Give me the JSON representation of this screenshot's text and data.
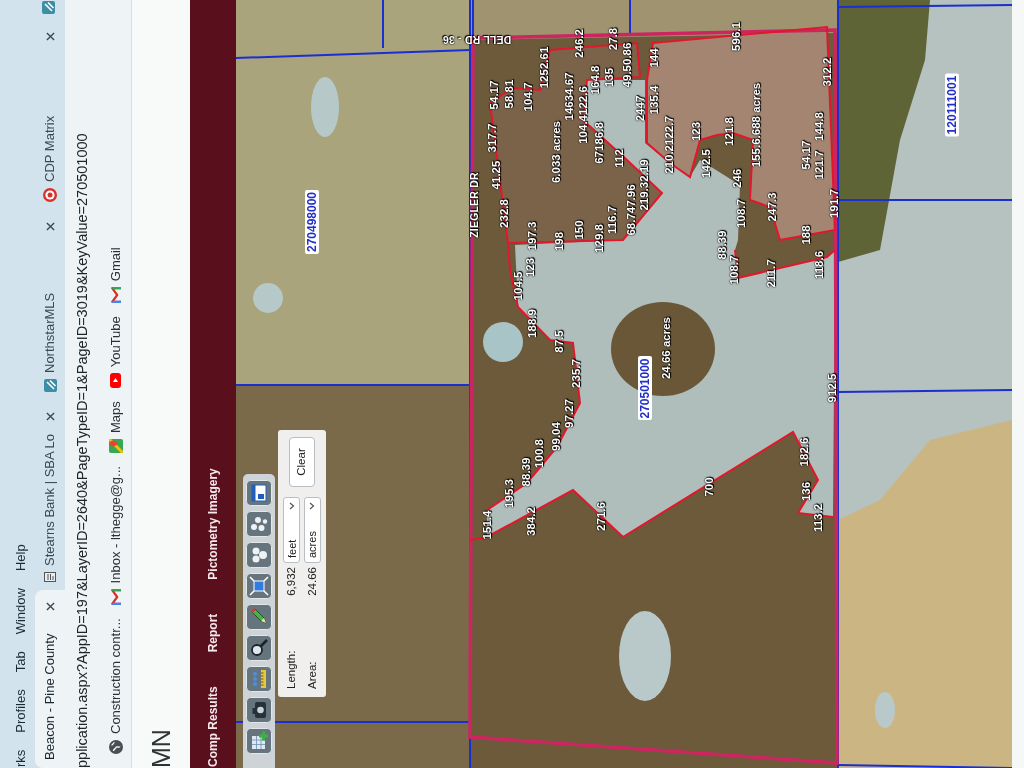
{
  "menu_bar": {
    "items": [
      "rks",
      "Profiles",
      "Tab",
      "Window",
      "Help"
    ]
  },
  "tabs": [
    {
      "title": "Beacon - Pine County",
      "selected": true
    },
    {
      "title": "Stearns Bank | SBA Lo",
      "selected": false
    },
    {
      "title": "NorthstarMLS",
      "selected": false
    },
    {
      "title": "CDP Matrix",
      "selected": false
    }
  ],
  "address_bar": {
    "url": "pplication.aspx?AppID=197&LayerID=2640&PageTypeID=1&PageID=3019&KeyValue=270501000"
  },
  "bookmarks": [
    "Construction contr...",
    "Inbox - lthegge@g...",
    "Maps",
    "YouTube",
    "Gmail"
  ],
  "header": {
    "title": "MN"
  },
  "nav": [
    "Comp Results",
    "Report",
    "Pictometry Imagery"
  ],
  "map": {
    "measure_panel": {
      "rows": [
        {
          "label": "Length:",
          "value": "6,932",
          "unit": "feet"
        },
        {
          "label": "Area:",
          "value": "24.66",
          "unit": "acres"
        }
      ],
      "clear_button": "Clear"
    },
    "labels": [
      {
        "kind": "parcel",
        "text": "270498000"
      },
      {
        "kind": "road",
        "text": "DELL RD - 36"
      },
      {
        "kind": "road",
        "text": "ZIEGLER DR"
      },
      {
        "kind": "measure",
        "text": "151.4"
      },
      {
        "kind": "measure",
        "text": "54.17"
      },
      {
        "kind": "measure",
        "text": "317.7"
      },
      {
        "kind": "measure",
        "text": "41.25"
      },
      {
        "kind": "measure",
        "text": "232.8"
      },
      {
        "kind": "measure",
        "text": "58.81"
      },
      {
        "kind": "measure",
        "text": "195.3"
      },
      {
        "kind": "measure",
        "text": "104.5"
      },
      {
        "kind": "measure",
        "text": "123"
      },
      {
        "kind": "measure",
        "text": "104.7"
      },
      {
        "kind": "measure",
        "text": "88.39"
      },
      {
        "kind": "measure",
        "text": "384.2"
      },
      {
        "kind": "measure",
        "text": "197.3"
      },
      {
        "kind": "measure",
        "text": "188.9"
      },
      {
        "kind": "measure",
        "text": "100.8"
      },
      {
        "kind": "measure",
        "text": "1252.61"
      },
      {
        "kind": "measure",
        "text": "6.033 acres"
      },
      {
        "kind": "measure",
        "text": "99.04"
      },
      {
        "kind": "measure",
        "text": "198"
      },
      {
        "kind": "measure",
        "text": "87.5"
      },
      {
        "kind": "measure",
        "text": "97.27"
      },
      {
        "kind": "measure",
        "text": "14634.67"
      },
      {
        "kind": "measure",
        "text": "235.7"
      },
      {
        "kind": "measure",
        "text": "150"
      },
      {
        "kind": "measure",
        "text": "246.2"
      },
      {
        "kind": "measure",
        "text": "104.4122.6"
      },
      {
        "kind": "measure",
        "text": "164.8"
      },
      {
        "kind": "measure",
        "text": "67186.8"
      },
      {
        "kind": "measure",
        "text": "271.6"
      },
      {
        "kind": "measure",
        "text": "129.8"
      },
      {
        "kind": "measure",
        "text": "135"
      },
      {
        "kind": "measure",
        "text": "116.7"
      },
      {
        "kind": "measure",
        "text": "27.8"
      },
      {
        "kind": "measure",
        "text": "112"
      },
      {
        "kind": "measure",
        "text": "49.50.86"
      },
      {
        "kind": "measure",
        "text": "68.747.96"
      },
      {
        "kind": "measure",
        "text": "219.32.19"
      },
      {
        "kind": "parcel",
        "text": "270501000"
      },
      {
        "kind": "measure",
        "text": "2447"
      },
      {
        "kind": "measure",
        "text": "135.4"
      },
      {
        "kind": "measure",
        "text": "144"
      },
      {
        "kind": "measure",
        "text": "24.66 acres"
      },
      {
        "kind": "measure",
        "text": "210.2122.7"
      },
      {
        "kind": "measure",
        "text": "123"
      },
      {
        "kind": "measure",
        "text": "142.5"
      },
      {
        "kind": "measure",
        "text": "700"
      },
      {
        "kind": "measure",
        "text": "88.39"
      },
      {
        "kind": "measure",
        "text": "121.8"
      },
      {
        "kind": "measure",
        "text": "108.7"
      },
      {
        "kind": "measure",
        "text": "596.1"
      },
      {
        "kind": "measure",
        "text": "246"
      },
      {
        "kind": "measure",
        "text": "108.7"
      },
      {
        "kind": "measure",
        "text": "155.6.688 acres"
      },
      {
        "kind": "measure",
        "text": "211.7"
      },
      {
        "kind": "measure",
        "text": "247.3"
      },
      {
        "kind": "measure",
        "text": "182.6"
      },
      {
        "kind": "measure",
        "text": "54.17"
      },
      {
        "kind": "measure",
        "text": "188"
      },
      {
        "kind": "measure",
        "text": "136"
      },
      {
        "kind": "measure",
        "text": "113.2"
      },
      {
        "kind": "measure",
        "text": "144.8"
      },
      {
        "kind": "measure",
        "text": "121.7"
      },
      {
        "kind": "measure",
        "text": "118.6"
      },
      {
        "kind": "measure",
        "text": "312.2"
      },
      {
        "kind": "measure",
        "text": "912.5"
      },
      {
        "kind": "measure",
        "text": "191.7"
      },
      {
        "kind": "parcel",
        "text": "120111001"
      }
    ]
  }
}
